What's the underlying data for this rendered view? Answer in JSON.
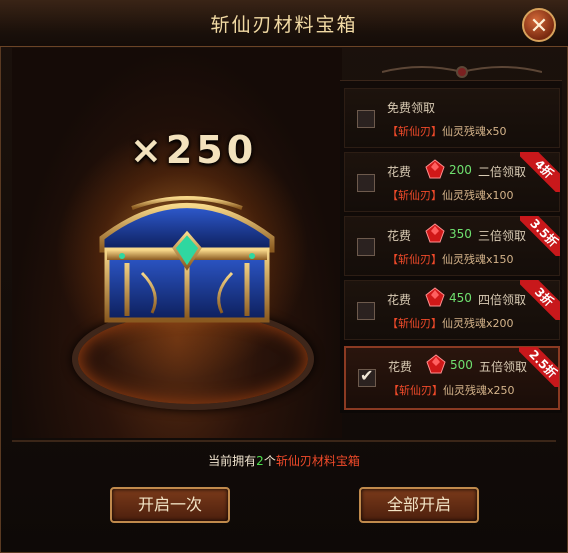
{
  "title": "斩仙刃材料宝箱",
  "close_label": "✕",
  "multiplier": "×250",
  "options": [
    {
      "line1": "免费领取",
      "item_prefix": "【斩仙刃】",
      "item_name": "仙灵残魂",
      "item_count": "x50",
      "checked": false,
      "discount": ""
    },
    {
      "cost_label": "花费",
      "amount": "200",
      "mult": "二倍领取",
      "item_prefix": "【斩仙刃】",
      "item_name": "仙灵残魂",
      "item_count": "x100",
      "checked": false,
      "discount": "4折"
    },
    {
      "cost_label": "花费",
      "amount": "350",
      "mult": "三倍领取",
      "item_prefix": "【斩仙刃】",
      "item_name": "仙灵残魂",
      "item_count": "x150",
      "checked": false,
      "discount": "3.5折"
    },
    {
      "cost_label": "花费",
      "amount": "450",
      "mult": "四倍领取",
      "item_prefix": "【斩仙刃】",
      "item_name": "仙灵残魂",
      "item_count": "x200",
      "checked": false,
      "discount": "3折"
    },
    {
      "cost_label": "花费",
      "amount": "500",
      "mult": "五倍领取",
      "item_prefix": "【斩仙刃】",
      "item_name": "仙灵残魂",
      "item_count": "x250",
      "checked": true,
      "discount": "2.5折"
    }
  ],
  "owned": {
    "prefix": "当前拥有",
    "count": "2",
    "unit": "个",
    "item": "斩仙刃材料宝箱"
  },
  "buttons": {
    "open_once": "开启一次",
    "open_all": "全部开启"
  },
  "icons": {
    "close": "close-icon",
    "gem": "red-gem-icon",
    "chest": "treasure-chest-icon"
  },
  "colors": {
    "accent_red": "#f04a2a",
    "accent_green": "#4fe04f",
    "ribbon_red": "#c8181b",
    "gold": "#c08a4c"
  }
}
